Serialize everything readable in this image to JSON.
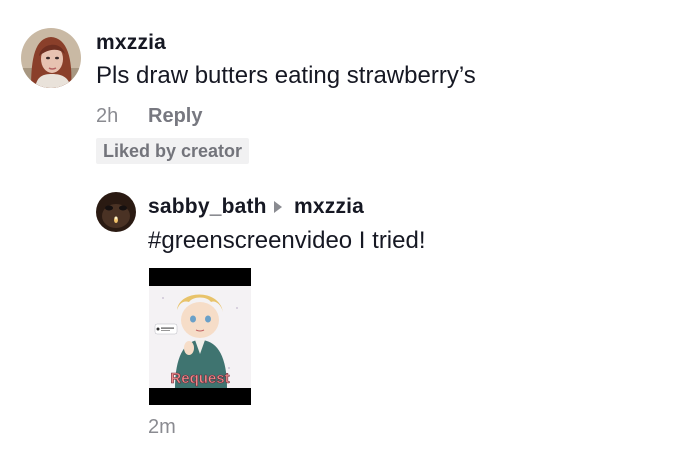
{
  "comment": {
    "username": "mxzzia",
    "text": "Pls draw butters eating strawberry’s",
    "time": "2h",
    "reply_label": "Reply",
    "liked_badge": "Liked by creator"
  },
  "reply": {
    "username": "sabby_bath",
    "reply_to": "mxzzia",
    "text": "#greenscreenvideo I tried!",
    "time": "2m",
    "video_overlay_label": "Request",
    "arrow_icon": "caret-right-icon"
  },
  "colors": {
    "text_primary": "#161823",
    "text_secondary": "#8a8b91",
    "badge_bg": "#f1f1f2"
  }
}
